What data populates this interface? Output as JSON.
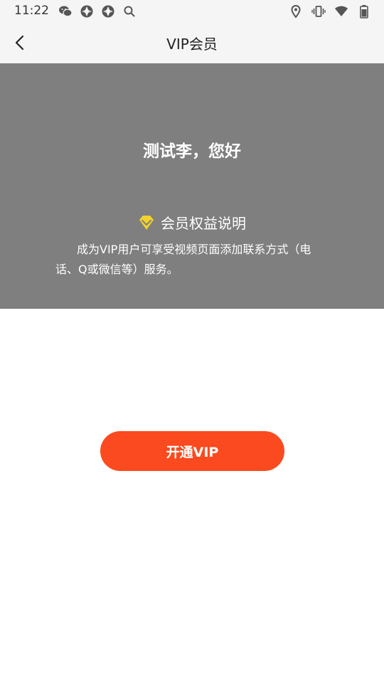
{
  "status_bar": {
    "time": "11:22",
    "left_icons": [
      "wechat-icon",
      "app-shutter-icon",
      "app-shutter-icon",
      "search-icon"
    ],
    "right_icons": [
      "location-icon",
      "vibrate-icon",
      "wifi-icon",
      "battery-icon"
    ]
  },
  "title_bar": {
    "back_icon": "chevron-left-icon",
    "title": "VIP会员"
  },
  "hero": {
    "background_color": "#7f7f7f",
    "greeting": "测试李，您好",
    "benefits_icon": "diamond-icon",
    "benefits_icon_color": "#f2d22c",
    "benefits_title": "会员权益说明",
    "benefits_description": "成为VIP用户可享受视频页面添加联系方式（电话、Q或微信等）服务。"
  },
  "actions": {
    "open_vip_label": "开通VIP",
    "button_color": "#fb4a1f"
  }
}
